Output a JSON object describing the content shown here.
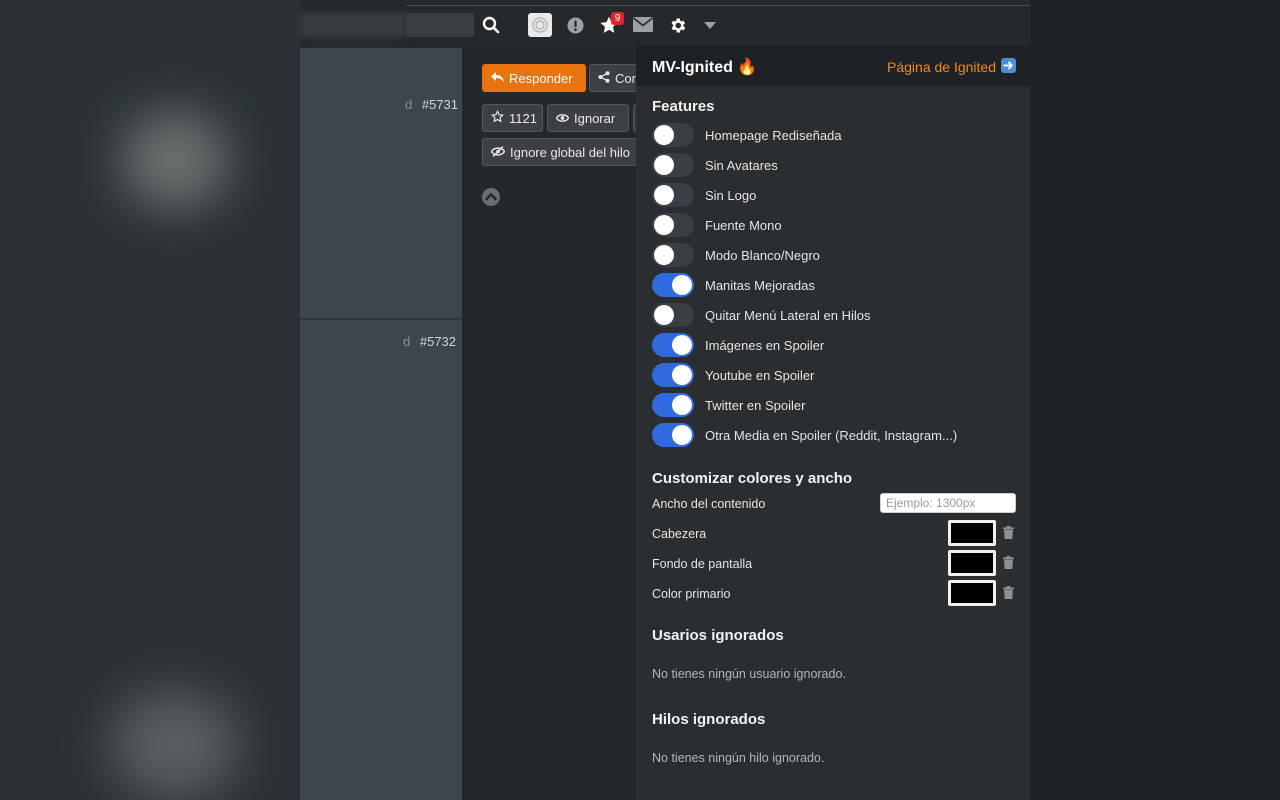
{
  "header": {
    "notification_count": "9",
    "icons": [
      "search-icon",
      "avatar",
      "alert-icon",
      "star-icon",
      "mail-icon",
      "gear-icon",
      "caret-down-icon"
    ]
  },
  "thread": {
    "reply_label": "Responder",
    "share_label": "Con",
    "favorites_count": "1121",
    "ignore_label": "Ignorar",
    "global_ignore_label": "Ignore global del hilo",
    "posts": [
      {
        "partial": "d",
        "number": "#5731"
      },
      {
        "partial": "d",
        "number": "#5732"
      }
    ]
  },
  "panel": {
    "title": "MV-Ignited",
    "title_emoji": "🔥",
    "link_label": "Página de Ignited",
    "link_arrow": "➡️",
    "features_title": "Features",
    "features": [
      {
        "label": "Homepage Rediseñada",
        "on": false
      },
      {
        "label": "Sin Avatares",
        "on": false
      },
      {
        "label": "Sin Logo",
        "on": false
      },
      {
        "label": "Fuente Mono",
        "on": false
      },
      {
        "label": "Modo Blanco/Negro",
        "on": false
      },
      {
        "label": "Manitas Mejoradas",
        "on": true
      },
      {
        "label": "Quitar Menú Lateral en Hilos",
        "on": false
      },
      {
        "label": "Imágenes en Spoiler",
        "on": true
      },
      {
        "label": "Youtube en Spoiler",
        "on": true
      },
      {
        "label": "Twitter en Spoiler",
        "on": true
      },
      {
        "label": "Otra Media en Spoiler (Reddit, Instagram...)",
        "on": true
      }
    ],
    "customize_title": "Customizar colores y ancho",
    "width_label": "Ancho del contenido",
    "width_placeholder": "Ejemplo: 1300px",
    "width_value": "",
    "colors": [
      {
        "label": "Cabezera",
        "value": "#000000"
      },
      {
        "label": "Fondo de pantalla",
        "value": "#000000"
      },
      {
        "label": "Color primario",
        "value": "#000000"
      }
    ],
    "ignored_users_title": "Usarios ignorados",
    "ignored_users_empty": "No tienes ningún usuario ignorado.",
    "ignored_threads_title": "Hilos ignorados",
    "ignored_threads_empty": "No tienes ningún hilo ignorado."
  },
  "colors": {
    "accent_orange": "#e8730f",
    "link_orange": "#ef8b1e",
    "toggle_on": "#2f6bdf",
    "badge_red": "#e0242c"
  }
}
